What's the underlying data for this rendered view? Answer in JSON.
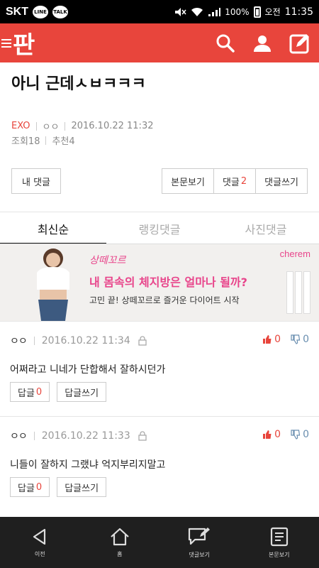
{
  "statusbar": {
    "carrier": "SKT",
    "apps": [
      "LINE",
      "TALK"
    ],
    "battery": "100%",
    "time_label": "오전",
    "time": "11:35"
  },
  "appbar": {
    "logo": "판",
    "icons": [
      "menu-icon",
      "search-icon",
      "user-icon",
      "edit-icon"
    ]
  },
  "article": {
    "title": "아니 근데ㅅㅂㅋㅋㅋ",
    "tag": "EXO",
    "author": "ㅇㅇ",
    "date": "2016.10.22 11:32",
    "views": "조회18",
    "recommends": "추천4"
  },
  "buttons": {
    "my_comments": "내 댓글",
    "view_original": "본문보기",
    "comments_label": "댓글",
    "comments_count": "2",
    "write_comment": "댓글쓰기"
  },
  "tabs": [
    "최신순",
    "랭킹댓글",
    "사진댓글"
  ],
  "ad": {
    "script": "상떼꼬르",
    "brand": "cherem",
    "headline": "내 몸속의 체지방은 얼마나 될까?",
    "subline": "고민 끝! 상떼꼬르로 즐거운 다이어트 시작"
  },
  "comments": [
    {
      "author": "ㅇㅇ",
      "date": "2016.10.22 11:34",
      "up": "0",
      "down": "0",
      "text": "어쩌라고 니네가 단합해서 잘하시던가",
      "reply_label": "답글",
      "reply_count": "0",
      "write_reply": "답글쓰기"
    },
    {
      "author": "ㅇㅇ",
      "date": "2016.10.22 11:33",
      "up": "0",
      "down": "0",
      "text": "니들이 잘하지 그랬냐 억지부리지말고",
      "reply_label": "답글",
      "reply_count": "0",
      "write_reply": "답글쓰기"
    }
  ],
  "bottomnav": [
    {
      "label": "이전",
      "icon": "back-icon"
    },
    {
      "label": "홈",
      "icon": "home-icon"
    },
    {
      "label": "댓글보기",
      "icon": "comment-icon"
    },
    {
      "label": "본문보기",
      "icon": "document-icon"
    }
  ],
  "colors": {
    "brand_red": "#e8453c",
    "ad_pink": "#e8458b",
    "nav_dark": "#1f1f1f"
  }
}
